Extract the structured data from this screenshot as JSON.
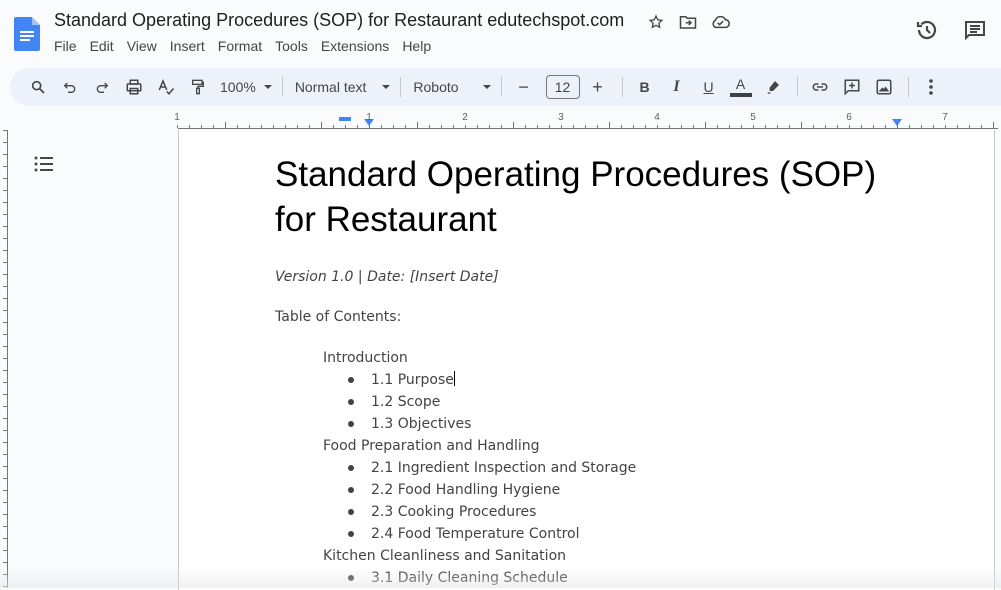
{
  "app": {
    "doc_title": "Standard Operating Procedures (SOP) for Restaurant edutechspot.com",
    "menu": [
      "File",
      "Edit",
      "View",
      "Insert",
      "Format",
      "Tools",
      "Extensions",
      "Help"
    ],
    "title_icons": [
      "star-icon",
      "move-to-folder-icon",
      "cloud-saved-icon"
    ],
    "right_icons": [
      "version-history-icon",
      "comments-icon"
    ],
    "brand_color": "#4285f4"
  },
  "toolbar": {
    "zoom": "100%",
    "style": "Normal text",
    "font": "Roboto",
    "font_size": "12",
    "decrease": "−",
    "increase": "+",
    "bold": "B",
    "italic": "I",
    "underline": "U",
    "text_color": "A"
  },
  "ruler": {
    "labels": [
      "1",
      "1",
      "2",
      "3",
      "4",
      "5",
      "6",
      "7"
    ]
  },
  "document": {
    "title": "Standard Operating Procedures (SOP) for Restaurant",
    "subtitle": "Version 1.0 | Date: [Insert Date]",
    "toc_heading": "Table of Contents:",
    "sections": [
      {
        "title": "Introduction",
        "items": [
          "1.1 Purpose",
          "1.2 Scope",
          "1.3 Objectives"
        ]
      },
      {
        "title": "Food Preparation and Handling",
        "items": [
          "2.1 Ingredient Inspection and Storage",
          "2.2 Food Handling Hygiene",
          "2.3 Cooking Procedures",
          "2.4 Food Temperature Control"
        ]
      },
      {
        "title": "Kitchen Cleanliness and Sanitation",
        "items": [
          "3.1 Daily Cleaning Schedule"
        ]
      }
    ]
  }
}
